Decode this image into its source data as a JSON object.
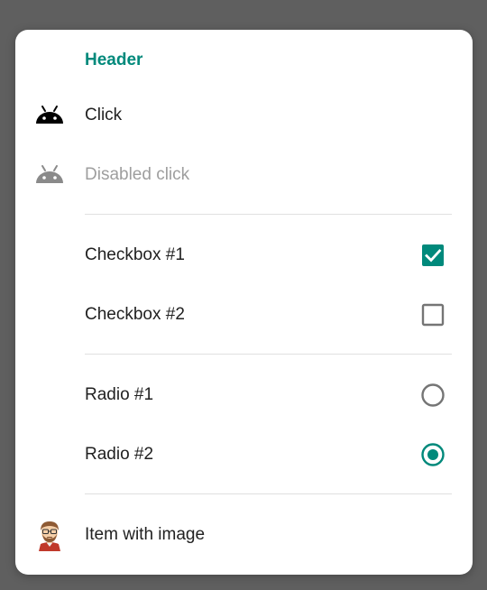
{
  "colors": {
    "accent": "#00897b",
    "text": "#212121",
    "disabled": "#9e9e9e",
    "unchecked": "#757575"
  },
  "menu": {
    "header": "Header",
    "items": [
      {
        "label": "Click",
        "icon": "android-icon",
        "enabled": true
      },
      {
        "label": "Disabled click",
        "icon": "android-icon",
        "enabled": false
      }
    ],
    "checkboxes": [
      {
        "label": "Checkbox #1",
        "checked": true
      },
      {
        "label": "Checkbox #2",
        "checked": false
      }
    ],
    "radios": [
      {
        "label": "Radio #1",
        "selected": false
      },
      {
        "label": "Radio #2",
        "selected": true
      }
    ],
    "image_item": {
      "label": "Item with image",
      "icon": "avatar-image"
    }
  }
}
